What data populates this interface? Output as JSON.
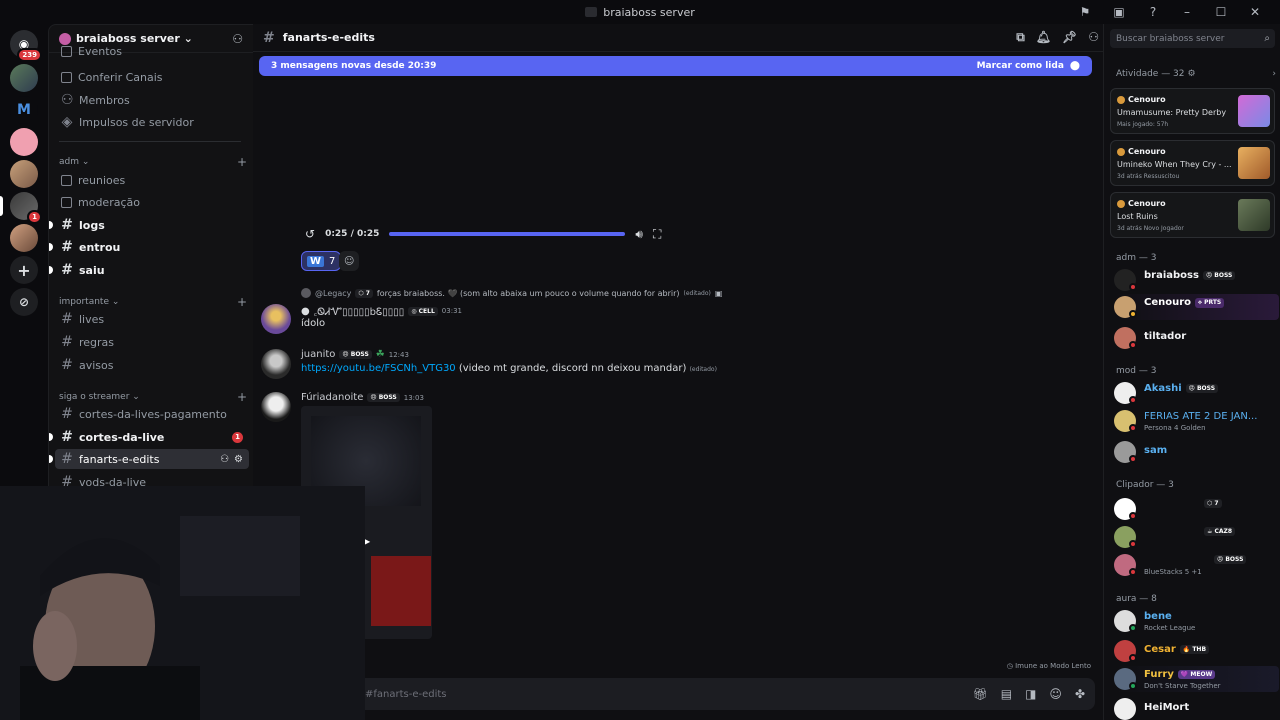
{
  "window": {
    "title": "braiaboss server"
  },
  "rail": {
    "dm_badge": "239",
    "m_glyph": "M",
    "server_badge": "1",
    "add_glyph": "+"
  },
  "sidebar": {
    "server_name": "braiaboss server ⌄",
    "top_items": [
      "Eventos",
      "Conferir Canais",
      "Membros",
      "Impulsos de servidor"
    ],
    "categories": {
      "adm": "adm ⌄",
      "importante": "importante ⌄",
      "streamer": "siga o streamer ⌄"
    },
    "channels": {
      "reunioes": "reunioes",
      "moderacao": "moderação",
      "logs": "logs",
      "entrou": "entrou",
      "saiu": "saiu",
      "lives": "lives",
      "regras": "regras",
      "avisos": "avisos",
      "cortes_pag": "cortes-da-lives-pagamento",
      "cortes": "cortes-da-live",
      "cortes_badge": "1",
      "fanarts": "fanarts-e-edits",
      "vods": "vods-da-live"
    }
  },
  "main": {
    "channel": "fanarts-e-edits",
    "new_messages": "3 mensagens novas desde 20:39",
    "mark_read": "Marcar como lida",
    "player_time": "0:25 / 0:25",
    "reaction_count": "7",
    "reply": {
      "ref_user": "@Legacy",
      "ref_tag": "7",
      "ref_text": "forças braiaboss. 🖤 (som alto abaixa um pouco o volume quando for abrir)",
      "ref_edited": "(editado)",
      "author": "꜀ᏫᏗᏉ▯▯▯▯▯bᏋ▯▯▯▯",
      "tag": "CELL",
      "time": "03:31",
      "text": "ídolo"
    },
    "msg2": {
      "author": "juanito",
      "tag": "BOSS",
      "time": "12:43",
      "link": "https://youtu.be/FSCNh_VTG30",
      "text": " (video mt grande, discord nn deixou mandar)",
      "edited": "(editado)"
    },
    "msg3": {
      "author": "Fúriadanoite",
      "tag": "BOSS",
      "time": "13:03"
    },
    "slowmode": "Imune ao Modo Lento",
    "input_placeholder": "#fanarts-e-edits"
  },
  "right": {
    "search_placeholder": "Buscar braiaboss server",
    "activity_header": "Atividade — 32",
    "activity_cards": [
      {
        "user": "Cenouro",
        "game": "Umamusume: Pretty Derby",
        "status": "Mais jogado: 57h"
      },
      {
        "user": "Cenouro",
        "game": "Umineko When They Cry - ...",
        "status": "3d atrás   Ressuscitou"
      },
      {
        "user": "Cenouro",
        "game": "Lost Ruins",
        "status": "3d atrás   Novo Jogador"
      }
    ],
    "groups": {
      "adm": "adm — 3",
      "mod": "mod — 3",
      "clipador": "Clipador — 3",
      "aura": "aura — 8"
    },
    "members": {
      "braiaboss": "braiaboss",
      "braiaboss_tag": "BOSS",
      "cenouro": "Cenouro",
      "cenouro_tag": "PRTS",
      "tiltador": "tiltador",
      "akashi": "Akashi",
      "akashi_tag": "BOSS",
      "ferias": "FERIAS ATE 2 DE JAN...",
      "ferias_sub": "Persona 4 Golden",
      "sam": "sam",
      "clip1_tag": "7",
      "clip2_tag": "CAZ8",
      "clip3_tag": "BOSS",
      "clip3_sub": "BlueStacks 5 +1",
      "bene": "bene",
      "bene_sub": "Rocket League",
      "cesar": "Cesar",
      "cesar_tag": "THB",
      "furry": "Furry",
      "furry_tag": "MEOW",
      "furry_sub": "Don't Starve Together",
      "heimort": "HeiMort"
    }
  }
}
